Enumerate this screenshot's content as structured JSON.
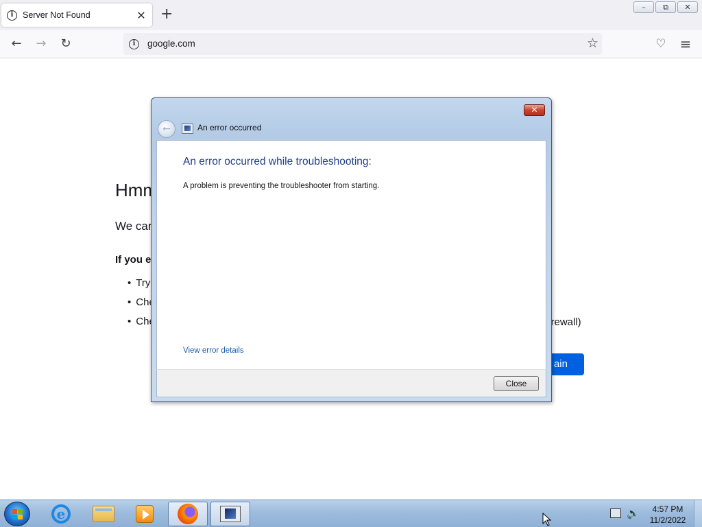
{
  "browser": {
    "tab": {
      "title": "Server Not Found",
      "close_glyph": "✕"
    },
    "newtab_glyph": "+",
    "window_buttons": {
      "minimize": "–",
      "restore": "⧉",
      "close": "✕"
    },
    "nav": {
      "back": "←",
      "forward": "→",
      "reload": "↻"
    },
    "url": "google.com",
    "bookmark_glyph": "☆",
    "pocket_glyph": "♡",
    "menu_glyph": "≡"
  },
  "page": {
    "heading": "Hmm",
    "subtitle": "We car",
    "if_you": "If you e",
    "list": [
      "Try",
      "Che",
      "Che"
    ],
    "firewall": "firewall)",
    "try_again": "ain"
  },
  "dialog": {
    "close_glyph": "✕",
    "back_glyph": "←",
    "title": "An error occurred",
    "heading": "An error occurred while troubleshooting:",
    "message": "A problem is preventing the troubleshooter from starting.",
    "details_link": "View error details",
    "close_button": "Close"
  },
  "taskbar": {
    "clock_time": "4:57 PM",
    "clock_date": "11/2/2022",
    "volume_glyph": "🔈"
  }
}
